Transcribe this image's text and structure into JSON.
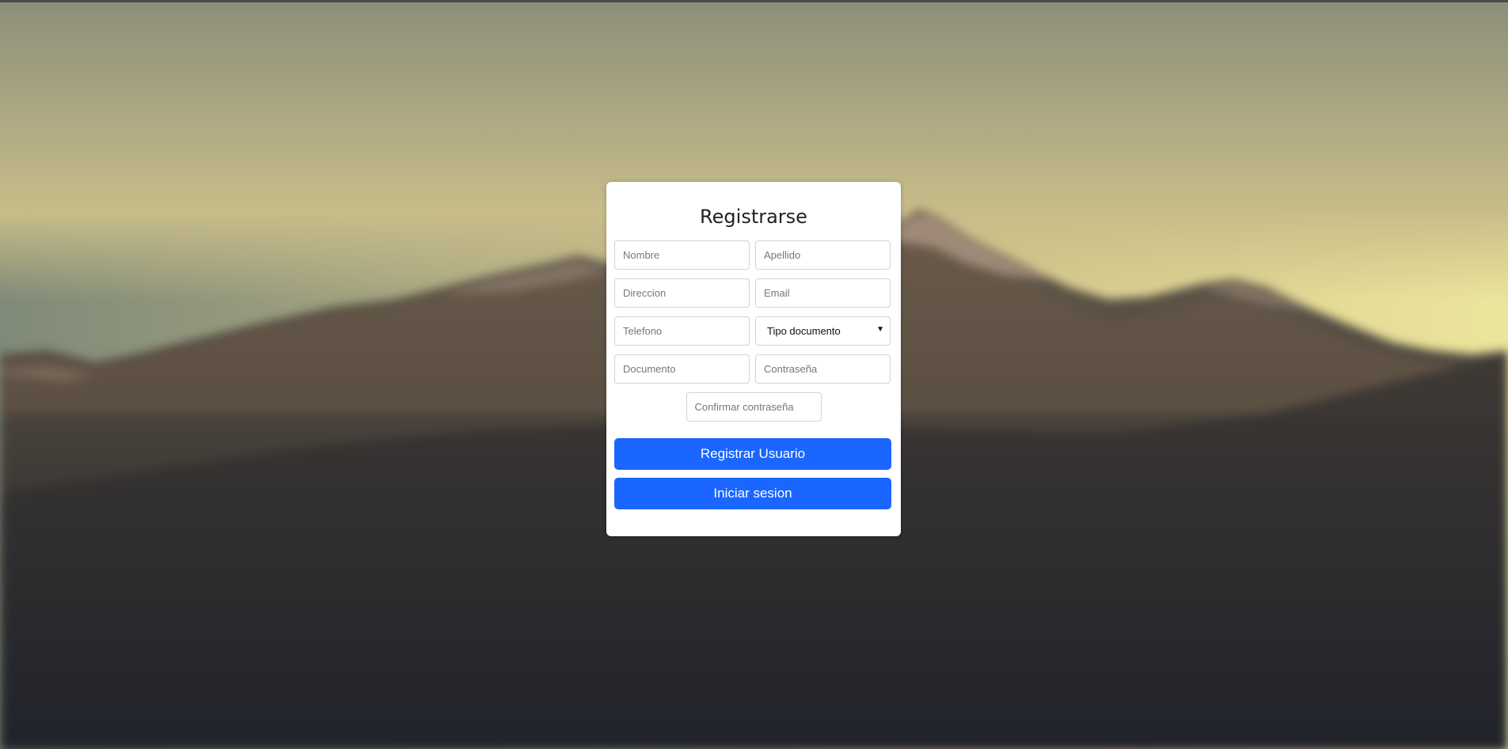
{
  "form": {
    "title": "Registrarse",
    "fields": {
      "nombre": {
        "placeholder": "Nombre"
      },
      "apellido": {
        "placeholder": "Apellido"
      },
      "direccion": {
        "placeholder": "Direccion"
      },
      "email": {
        "placeholder": "Email"
      },
      "telefono": {
        "placeholder": "Telefono"
      },
      "tipo_documento": {
        "selected": "Tipo documento"
      },
      "documento": {
        "placeholder": "Documento"
      },
      "contrasena": {
        "placeholder": "Contraseña"
      },
      "confirmar_contrasena": {
        "placeholder": "Confirmar contraseña"
      }
    },
    "buttons": {
      "register_label": "Registrar Usuario",
      "login_label": "Iniciar sesion"
    }
  },
  "icons": {
    "select_caret": "chevron-down-icon"
  },
  "colors": {
    "primary_button": "#1a66ff",
    "card_background": "#ffffff"
  }
}
